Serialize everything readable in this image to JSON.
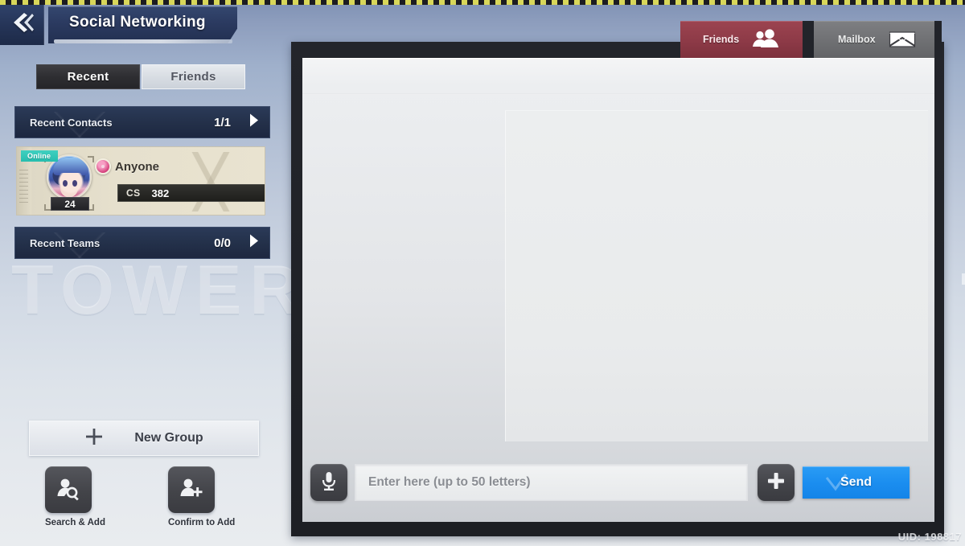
{
  "window": {
    "title": "Social Networking",
    "back_icon": "double-chevron-left-icon",
    "watermark": "TOWER",
    "uid": "UID: 198817"
  },
  "left_panel": {
    "tabs": [
      {
        "label": "Recent",
        "active": true
      },
      {
        "label": "Friends",
        "active": false
      }
    ],
    "sections": [
      {
        "id": "recent-contacts",
        "label": "Recent Contacts",
        "count": "1/1",
        "arrow_icon": "chevron-right-icon"
      },
      {
        "id": "recent-teams",
        "label": "Recent Teams",
        "count": "0/0",
        "arrow_icon": "chevron-right-icon"
      }
    ],
    "contact": {
      "status": "Online",
      "name": "Anyone",
      "level": "24",
      "stat_key": "CS",
      "stat_value": "382",
      "avatar_icon": "avatar-portrait",
      "badge_icon": "friend-mark-icon"
    },
    "new_group": {
      "label": "New Group",
      "icon": "plus-icon"
    },
    "actions": [
      {
        "id": "search-add",
        "label": "Search & Add",
        "icon": "user-search-icon"
      },
      {
        "id": "confirm-add",
        "label": "Confirm to Add",
        "icon": "user-plus-icon"
      }
    ]
  },
  "right_tabs": [
    {
      "id": "friends",
      "label": "Friends",
      "icon": "people-icon",
      "active": true
    },
    {
      "id": "mailbox",
      "label": "Mailbox",
      "icon": "envelope-icon",
      "active": false
    }
  ],
  "chat": {
    "input_placeholder": "Enter here (up to 50 letters)",
    "input_value": "",
    "mic_icon": "microphone-icon",
    "attach_icon": "plus-icon",
    "send_label": "Send",
    "send_check_icon": "check-icon"
  },
  "colors": {
    "title_bar": "#2b3a60",
    "tab_active": "#2e2e32",
    "friends_tab": "#8d3a47",
    "mailbox_tab": "#6f7073",
    "online_badge": "#2ec3b4",
    "send_button": "#1b8ef0",
    "card_bg": "#e6e0cd",
    "section_bar": "#233049"
  }
}
